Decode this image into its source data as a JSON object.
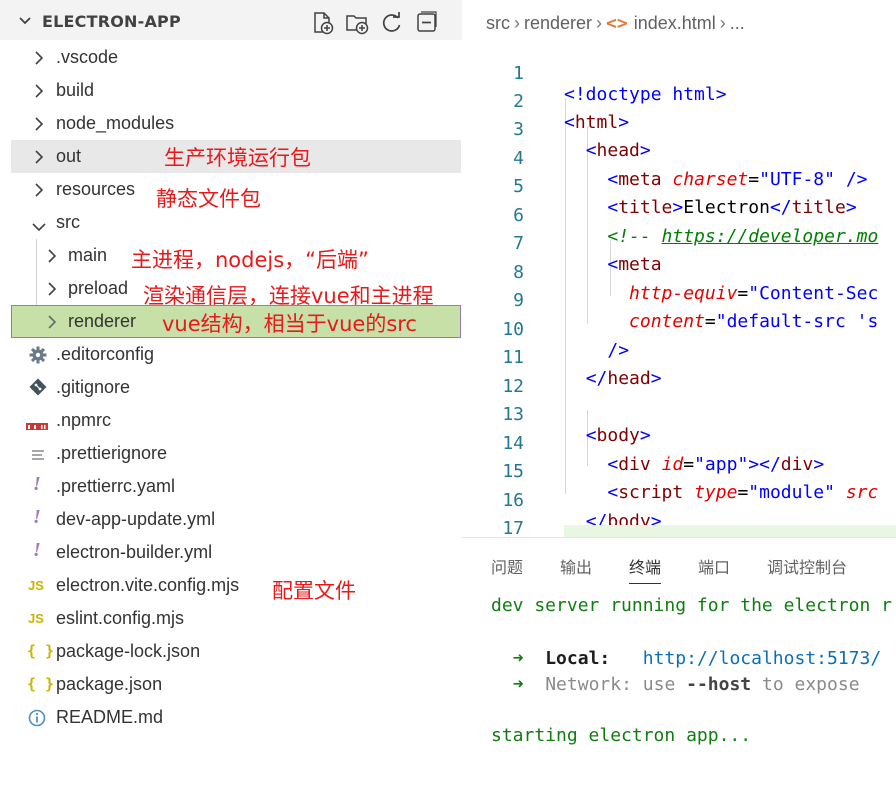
{
  "explorer": {
    "title": "ELECTRON-APP",
    "actions": [
      "new-file",
      "new-folder",
      "refresh",
      "collapse-all"
    ],
    "items": [
      {
        "label": ".vscode",
        "type": "folder",
        "state": "collapsed"
      },
      {
        "label": "build",
        "type": "folder",
        "state": "collapsed"
      },
      {
        "label": "node_modules",
        "type": "folder",
        "state": "collapsed"
      },
      {
        "label": "out",
        "type": "folder",
        "state": "collapsed",
        "annotation": "生产环境运行包"
      },
      {
        "label": "resources",
        "type": "folder",
        "state": "collapsed",
        "annotation": "静态文件包"
      },
      {
        "label": "src",
        "type": "folder",
        "state": "expanded"
      },
      {
        "label": "main",
        "type": "folder",
        "state": "collapsed",
        "annotation": "主进程，nodejs，“后端”"
      },
      {
        "label": "preload",
        "type": "folder",
        "state": "collapsed",
        "annotation": "渲染通信层，连接vue和主进程"
      },
      {
        "label": "renderer",
        "type": "folder",
        "state": "collapsed",
        "annotation": "vue结构，相当于vue的src"
      },
      {
        "label": ".editorconfig",
        "icon": "gear-icon"
      },
      {
        "label": ".gitignore",
        "icon": "git-icon"
      },
      {
        "label": ".npmrc",
        "icon": "npm-icon"
      },
      {
        "label": ".prettierignore",
        "icon": "lines-icon"
      },
      {
        "label": ".prettierrc.yaml",
        "icon": "yaml-icon"
      },
      {
        "label": "dev-app-update.yml",
        "icon": "yaml-icon"
      },
      {
        "label": "electron-builder.yml",
        "icon": "yaml-icon"
      },
      {
        "label": "electron.vite.config.mjs",
        "icon": "js-icon",
        "annotation": "配置文件"
      },
      {
        "label": "eslint.config.mjs",
        "icon": "js-icon"
      },
      {
        "label": "package-lock.json",
        "icon": "json-icon"
      },
      {
        "label": "package.json",
        "icon": "json-icon"
      },
      {
        "label": "README.md",
        "icon": "info-icon"
      }
    ],
    "icon_glyphs": {
      "js": "JS",
      "json": "{ }",
      "yaml": "!"
    }
  },
  "editor": {
    "breadcrumb": [
      "src",
      "renderer",
      "index.html",
      "..."
    ],
    "breadcrumb_icon": "<>",
    "lines": [
      {
        "n": "1"
      },
      {
        "n": "2"
      },
      {
        "n": "3"
      },
      {
        "n": "4"
      },
      {
        "n": "5"
      },
      {
        "n": "6"
      },
      {
        "n": "7"
      },
      {
        "n": "8"
      },
      {
        "n": "9"
      },
      {
        "n": "10"
      },
      {
        "n": "11"
      },
      {
        "n": "12"
      },
      {
        "n": "13"
      },
      {
        "n": "14"
      },
      {
        "n": "15"
      },
      {
        "n": "16"
      },
      {
        "n": "17"
      }
    ],
    "tokens": {
      "doctype": "<!doctype html>",
      "html": "html",
      "head": "head",
      "meta": "meta",
      "title": "title",
      "body": "body",
      "div": "div",
      "script": "script",
      "charset_attr": "charset",
      "charset_val": "\"UTF-8\"",
      "title_text": "Electron",
      "comment": "<!-- ",
      "comment_link": "https://developer.mo",
      "http_equiv_attr": "http-equiv",
      "http_equiv_val": "\"Content-Sec",
      "content_attr": "content",
      "content_val": "\"default-src 's",
      "id_attr": "id",
      "id_val": "\"app\"",
      "type_attr": "type",
      "type_val": "\"module\"",
      "src_attr": "src"
    },
    "colors": {
      "tag": "#800000",
      "attribute": "#e50000",
      "value": "#0000ff",
      "comment": "#008000"
    }
  },
  "panel": {
    "tabs": [
      "问题",
      "输出",
      "终端",
      "端口",
      "调试控制台"
    ],
    "active_tab": "终端",
    "terminal": {
      "line1": "dev server running for the electron r",
      "local_arrow": "➜",
      "local_label": "Local:",
      "local_url": "http://localhost:5173/",
      "network_arrow": "➜",
      "network_label": "Network:",
      "network_text_a": "use",
      "network_flag": "--host",
      "network_text_b": "to expose",
      "line_last": "starting electron app..."
    }
  }
}
